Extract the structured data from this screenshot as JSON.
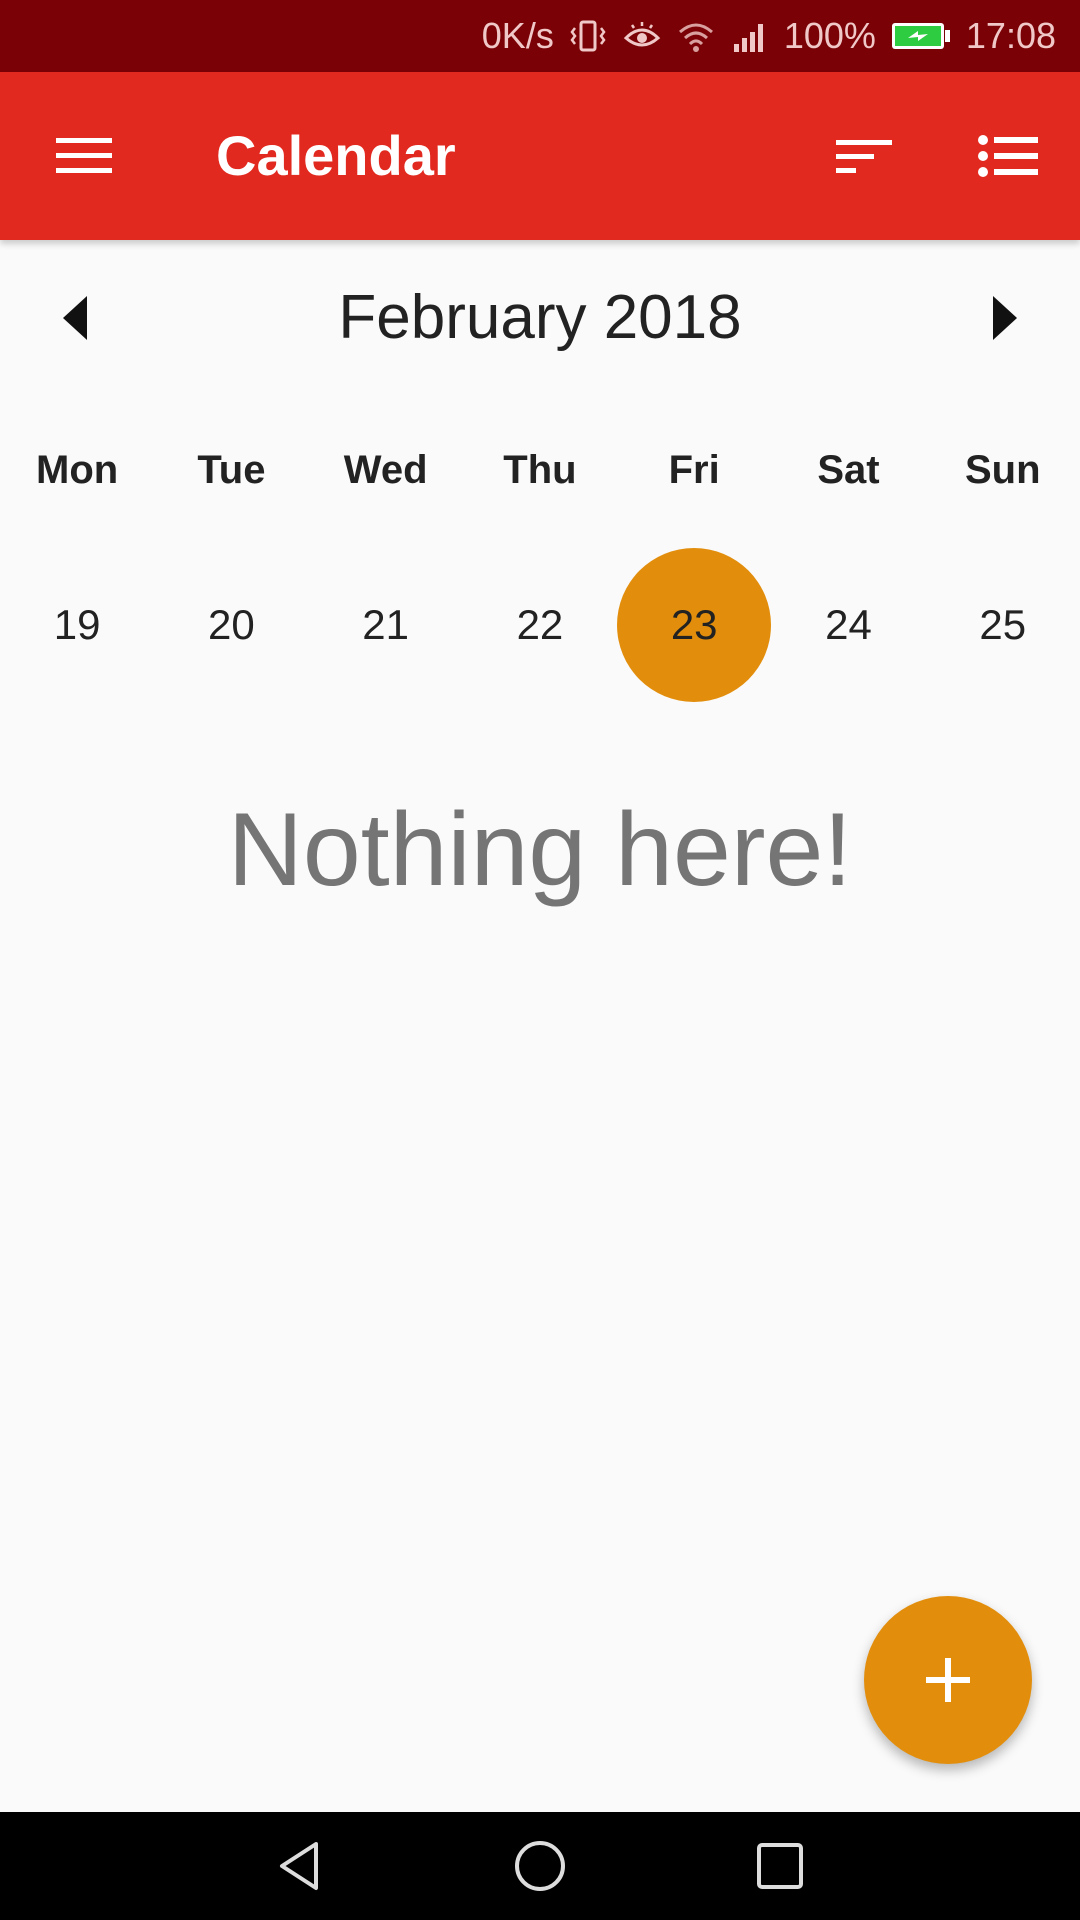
{
  "status_bar": {
    "net_speed": "0K/s",
    "battery": "100%",
    "time": "17:08",
    "icons": [
      "vibrate-icon",
      "eye-comfort-icon",
      "wifi-icon",
      "signal-icon",
      "battery-charging-icon"
    ]
  },
  "app_bar": {
    "title": "Calendar",
    "icons": [
      "menu-icon",
      "sort-icon",
      "list-view-icon"
    ]
  },
  "calendar": {
    "month_label": "February 2018",
    "weekdays": [
      "Mon",
      "Tue",
      "Wed",
      "Thu",
      "Fri",
      "Sat",
      "Sun"
    ],
    "dates": [
      "19",
      "20",
      "21",
      "22",
      "23",
      "24",
      "25"
    ],
    "selected_date": "23"
  },
  "empty_state": {
    "message": "Nothing here!"
  },
  "fab": {
    "icon": "add-icon"
  },
  "colors": {
    "status_bar": "#7a0206",
    "app_bar": "#e2291f",
    "accent": "#e28e0c",
    "background": "#fafafa"
  },
  "nav_bar": {
    "icons": [
      "back-icon",
      "home-icon",
      "recents-icon"
    ]
  }
}
